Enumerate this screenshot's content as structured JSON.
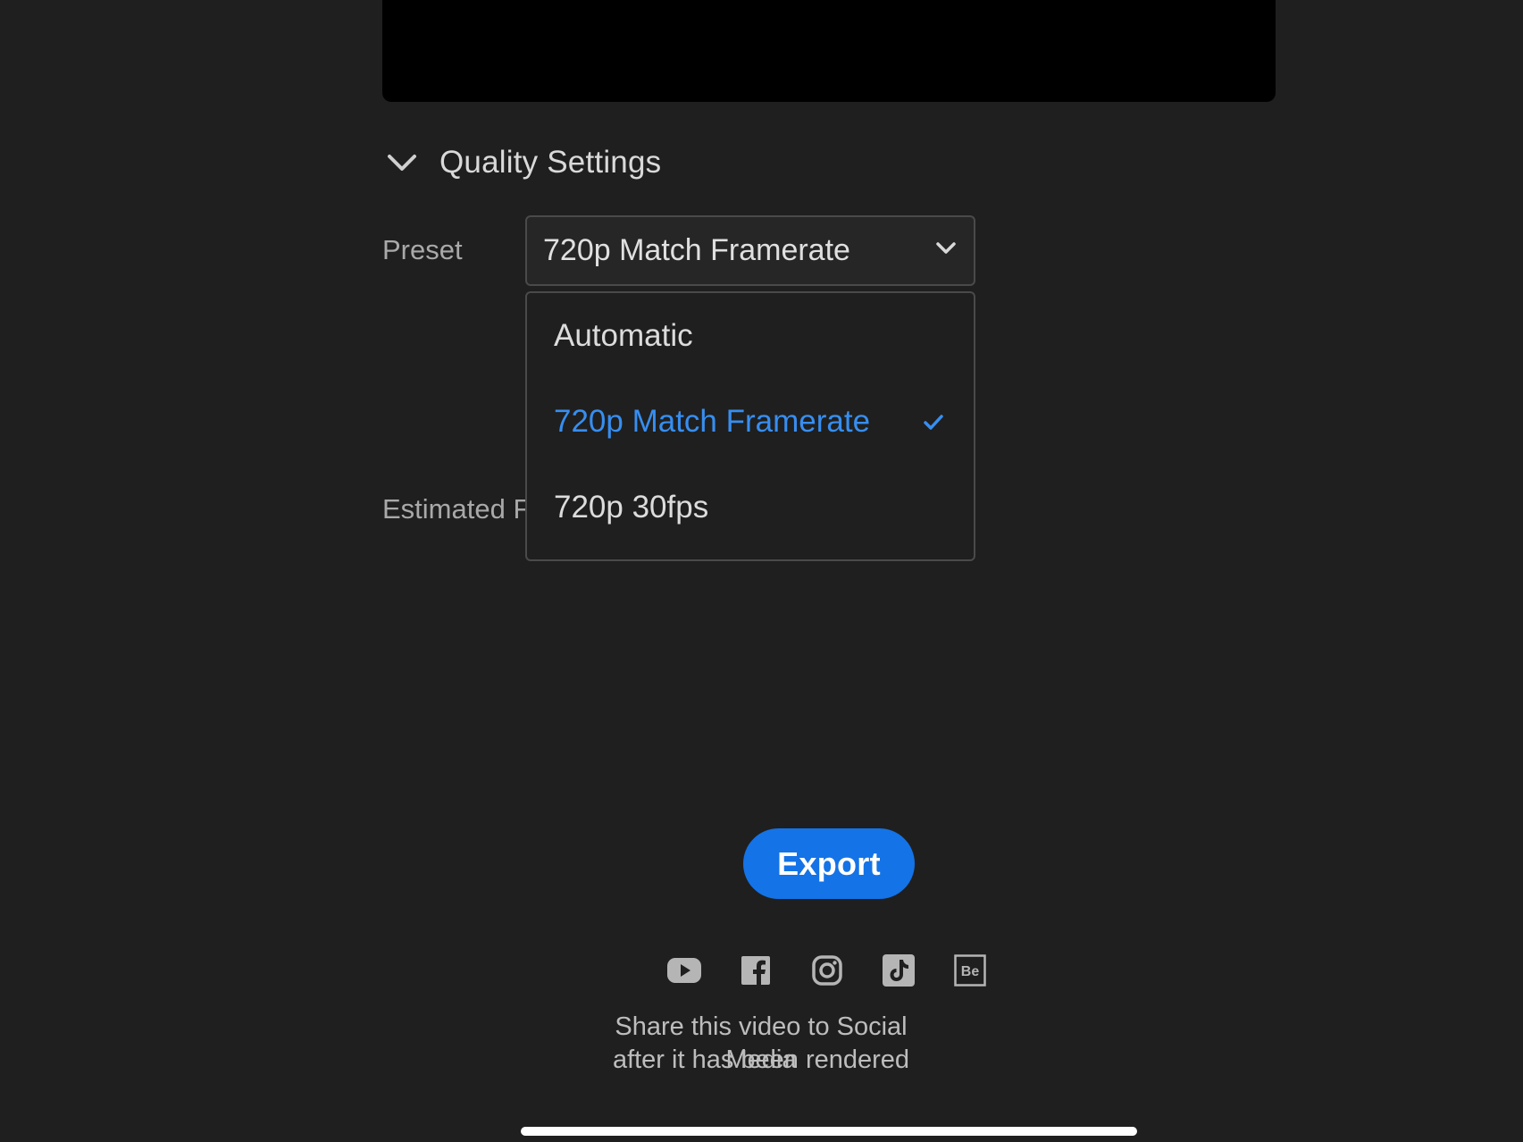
{
  "quality_settings": {
    "title": "Quality Settings"
  },
  "preset": {
    "label": "Preset",
    "selected_value": "720p Match Framerate",
    "options": [
      {
        "label": "Automatic",
        "selected": false
      },
      {
        "label": "720p Match Framerate",
        "selected": true
      },
      {
        "label": "720p 30fps",
        "selected": false
      }
    ]
  },
  "estimated": {
    "label_visible": "Estimated F"
  },
  "export": {
    "label": "Export"
  },
  "social": {
    "icons": [
      "youtube-icon",
      "facebook-icon",
      "instagram-icon",
      "tiktok-icon",
      "behance-icon"
    ],
    "behance_glyph": "Be",
    "share_line1": "Share this video to Social Media",
    "share_line2": "after it has been rendered"
  },
  "colors": {
    "background": "#1f1f1f",
    "accent_blue": "#1473e6",
    "selected_text": "#378ef0"
  }
}
